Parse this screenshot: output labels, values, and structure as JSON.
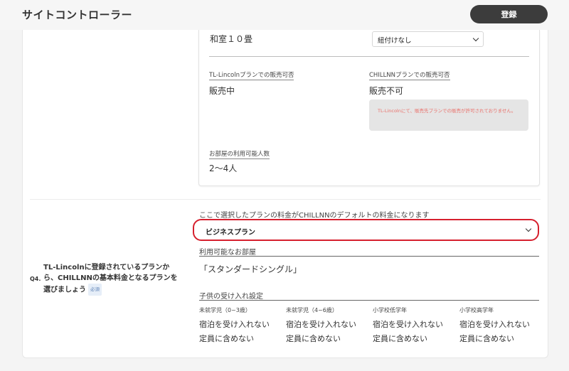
{
  "header": {
    "app_title": "サイトコントローラー",
    "register_label": "登録"
  },
  "room": {
    "type_name": "和室１０畳",
    "link_select_value": "紐付けなし",
    "tl_label": "TL-Lincolnプランでの販売可否",
    "tl_value": "販売中",
    "chillnn_label": "CHILLNNプランでの販売可否",
    "chillnn_value": "販売不可",
    "notice": "TL-Lincolnにて、販売先プランでの販売が許可されておりません。",
    "capacity_label": "お部屋の利用可能人数",
    "capacity_value": "2〜4人"
  },
  "question": {
    "number": "Q4.",
    "text": "TL-Lincolnに登録されているプランから、CHILLNNの基本料金となるプランを選びましょう",
    "required_badge": "必須"
  },
  "plan": {
    "hint": "ここで選択したプランの料金がCHILLNNのデフォルトの料金になります",
    "selected": "ビジネスプラン",
    "rooms_label": "利用可能なお部屋",
    "rooms_value": "「スタンダードシングル」",
    "children_label": "子供の受け入れ設定",
    "children": [
      {
        "category": "未就学児（0~3歳）",
        "acceptance": "宿泊を受け入れない",
        "capacity": "定員に含めない"
      },
      {
        "category": "未就学児（4~6歳）",
        "acceptance": "宿泊を受け入れない",
        "capacity": "定員に含めない"
      },
      {
        "category": "小学校低学年",
        "acceptance": "宿泊を受け入れない",
        "capacity": "定員に含めない"
      },
      {
        "category": "小学校高学年",
        "acceptance": "宿泊を受け入れない",
        "capacity": "定員に含めない"
      }
    ]
  },
  "colors": {
    "highlight_border": "#d6202e",
    "notice_text": "#e9706a",
    "button_bg": "#3c3c3c"
  }
}
